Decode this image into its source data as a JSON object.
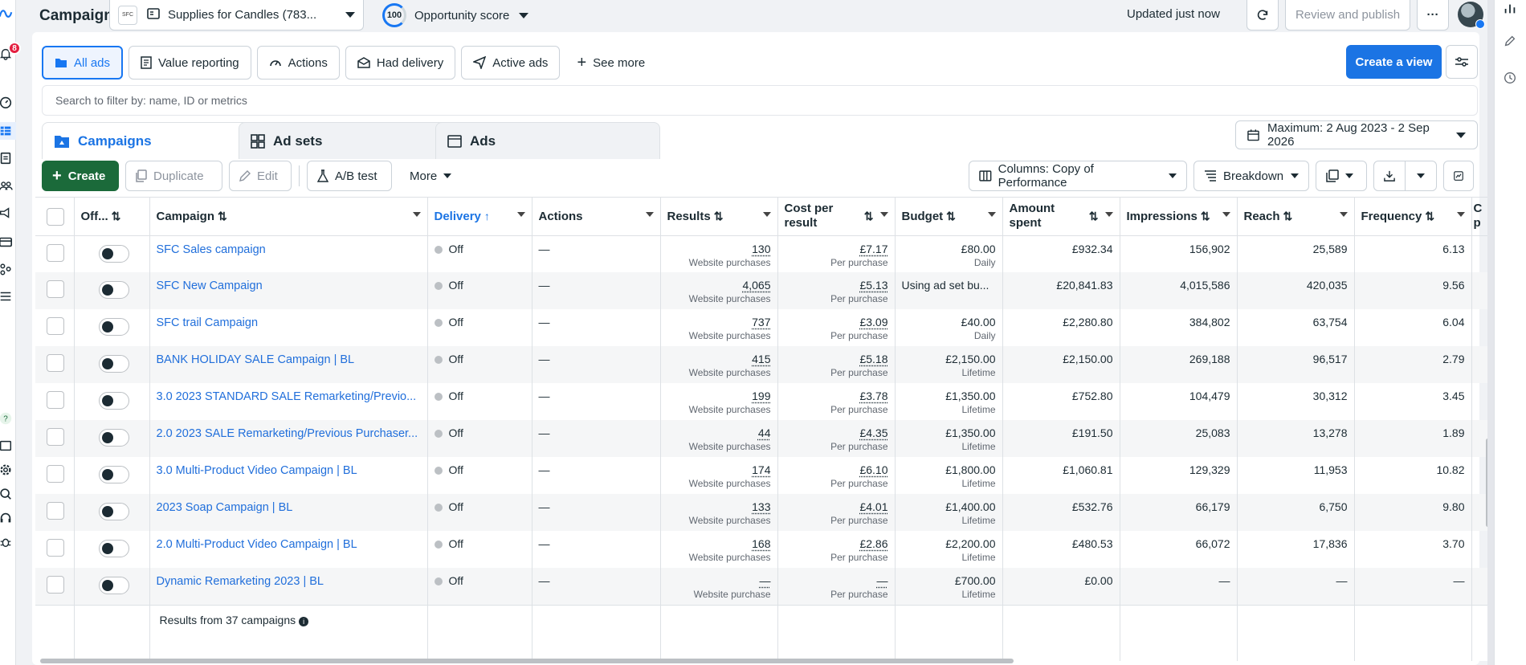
{
  "left_rail": {
    "notification_count": "8"
  },
  "topbar": {
    "title": "Campaigns",
    "account_logo_text": "SFC",
    "account_name": "Supplies for Candles (783...",
    "opportunity_score_value": "100",
    "opportunity_score_label": "Opportunity score",
    "updated_text": "Updated just now",
    "review_publish_label": "Review and publish",
    "more_label": "···"
  },
  "filters": {
    "chips": [
      "All ads",
      "Value reporting",
      "Actions",
      "Had delivery",
      "Active ads",
      "See more"
    ],
    "create_view_label": "Create a view",
    "search_placeholder": "Search to filter by: name, ID or metrics"
  },
  "level_tabs": [
    "Campaigns",
    "Ad sets",
    "Ads"
  ],
  "date_range": "Maximum: 2 Aug 2023 - 2 Sep 2026",
  "toolbar": {
    "create_label": "Create",
    "duplicate_label": "Duplicate",
    "edit_label": "Edit",
    "ab_test_label": "A/B test",
    "more_label": "More",
    "columns_label": "Columns: Copy of Performance",
    "breakdown_label": "Breakdown"
  },
  "table": {
    "headers": {
      "offon": "Off...",
      "campaign": "Campaign",
      "delivery": "Delivery",
      "actions": "Actions",
      "results": "Results",
      "cost_line1": "Cost per",
      "cost_line2": "result",
      "budget": "Budget",
      "amount_line1": "Amount",
      "amount_line2": "spent",
      "impressions": "Impressions",
      "reach": "Reach",
      "frequency": "Frequency",
      "cut_line1": "C",
      "cut_line2": "p"
    },
    "rows": [
      {
        "name": "SFC Sales campaign",
        "delivery": "Off",
        "actions": "—",
        "results": "130",
        "results_sub": "Website purchases",
        "cost": "£7.17",
        "cost_sub": "Per purchase",
        "budget": "£80.00",
        "budget_sub": "Daily",
        "amount": "£932.34",
        "impressions": "156,902",
        "reach": "25,589",
        "frequency": "6.13"
      },
      {
        "name": "SFC New Campaign",
        "delivery": "Off",
        "actions": "—",
        "results": "4,065",
        "results_sub": "Website purchases",
        "cost": "£5.13",
        "cost_sub": "Per purchase",
        "budget": "Using ad set bu...",
        "budget_sub": "",
        "amount": "£20,841.83",
        "impressions": "4,015,586",
        "reach": "420,035",
        "frequency": "9.56"
      },
      {
        "name": "SFC trail Campaign",
        "delivery": "Off",
        "actions": "—",
        "results": "737",
        "results_sub": "Website purchases",
        "cost": "£3.09",
        "cost_sub": "Per purchase",
        "budget": "£40.00",
        "budget_sub": "Daily",
        "amount": "£2,280.80",
        "impressions": "384,802",
        "reach": "63,754",
        "frequency": "6.04"
      },
      {
        "name": "BANK HOLIDAY SALE Campaign | BL",
        "delivery": "Off",
        "actions": "—",
        "results": "415",
        "results_sub": "Website purchases",
        "cost": "£5.18",
        "cost_sub": "Per purchase",
        "budget": "£2,150.00",
        "budget_sub": "Lifetime",
        "amount": "£2,150.00",
        "impressions": "269,188",
        "reach": "96,517",
        "frequency": "2.79"
      },
      {
        "name": "3.0 2023 STANDARD SALE Remarketing/Previo...",
        "delivery": "Off",
        "actions": "—",
        "results": "199",
        "results_sub": "Website purchases",
        "cost": "£3.78",
        "cost_sub": "Per purchase",
        "budget": "£1,350.00",
        "budget_sub": "Lifetime",
        "amount": "£752.80",
        "impressions": "104,479",
        "reach": "30,312",
        "frequency": "3.45"
      },
      {
        "name": "2.0 2023 SALE Remarketing/Previous Purchaser...",
        "delivery": "Off",
        "actions": "—",
        "results": "44",
        "results_sub": "Website purchases",
        "cost": "£4.35",
        "cost_sub": "Per purchase",
        "budget": "£1,350.00",
        "budget_sub": "Lifetime",
        "amount": "£191.50",
        "impressions": "25,083",
        "reach": "13,278",
        "frequency": "1.89"
      },
      {
        "name": "3.0 Multi-Product Video Campaign | BL",
        "delivery": "Off",
        "actions": "—",
        "results": "174",
        "results_sub": "Website purchases",
        "cost": "£6.10",
        "cost_sub": "Per purchase",
        "budget": "£1,800.00",
        "budget_sub": "Lifetime",
        "amount": "£1,060.81",
        "impressions": "129,329",
        "reach": "11,953",
        "frequency": "10.82"
      },
      {
        "name": "2023 Soap Campaign | BL",
        "delivery": "Off",
        "actions": "—",
        "results": "133",
        "results_sub": "Website purchases",
        "cost": "£4.01",
        "cost_sub": "Per purchase",
        "budget": "£1,400.00",
        "budget_sub": "Lifetime",
        "amount": "£532.76",
        "impressions": "66,179",
        "reach": "6,750",
        "frequency": "9.80"
      },
      {
        "name": "2.0 Multi-Product Video Campaign | BL",
        "delivery": "Off",
        "actions": "—",
        "results": "168",
        "results_sub": "Website purchases",
        "cost": "£2.86",
        "cost_sub": "Per purchase",
        "budget": "£2,200.00",
        "budget_sub": "Lifetime",
        "amount": "£480.53",
        "impressions": "66,072",
        "reach": "17,836",
        "frequency": "3.70"
      },
      {
        "name": "Dynamic Remarketing 2023 | BL",
        "delivery": "Off",
        "actions": "—",
        "results": "—",
        "results_sub": "Website purchase",
        "cost": "—",
        "cost_sub": "Per purchase",
        "budget": "£700.00",
        "budget_sub": "Lifetime",
        "amount": "£0.00",
        "impressions": "—",
        "reach": "—",
        "frequency": "—"
      }
    ],
    "footer_text": "Results from 37 campaigns"
  }
}
